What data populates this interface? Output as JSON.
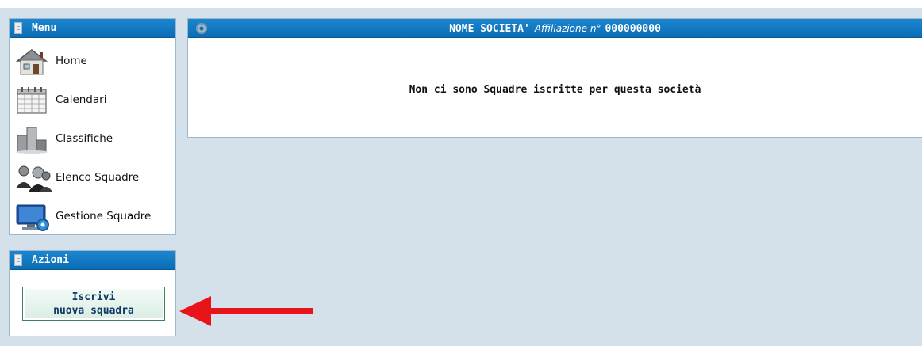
{
  "menu": {
    "title": "Menu",
    "items": [
      {
        "label": "Home",
        "icon": "home-icon"
      },
      {
        "label": "Calendari",
        "icon": "calendar-icon"
      },
      {
        "label": "Classifiche",
        "icon": "ranking-icon"
      },
      {
        "label": "Elenco Squadre",
        "icon": "teams-icon"
      },
      {
        "label": "Gestione Squadre",
        "icon": "team-management-icon"
      }
    ]
  },
  "actions": {
    "title": "Azioni",
    "button_line1": "Iscrivi",
    "button_line2": "nuova squadra"
  },
  "main": {
    "name": "NOME SOCIETA'",
    "affiliation_label": "Affiliazione n°",
    "affiliation_number": "000000000",
    "message": "Non ci sono Squadre iscritte per questa società"
  },
  "colors": {
    "header_blue": "#0b6db6",
    "background": "#d5e1ea",
    "arrow_red": "#e8141a"
  }
}
